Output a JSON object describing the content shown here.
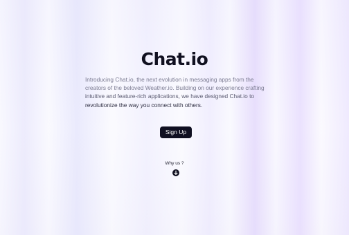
{
  "hero": {
    "title": "Chat.io",
    "intro_line1": "Introducing Chat.io, the next evolution in messaging apps from the",
    "intro_line2": "creators of the beloved Weather.io. Building on our experience crafting",
    "intro_line3": "intuitive and feature-rich applications, we have designed Chat.io to",
    "intro_line4": "revolutionize the way you connect with others.",
    "signup_label": "Sign Up",
    "why_label": "Why us ?",
    "scroll_icon": "arrow-down-circle-icon"
  },
  "colors": {
    "title": "#101020",
    "button_bg": "#101021",
    "button_text": "#ffffff",
    "body_text": "#5a5a70",
    "background_tint": "#e6e0fc"
  }
}
